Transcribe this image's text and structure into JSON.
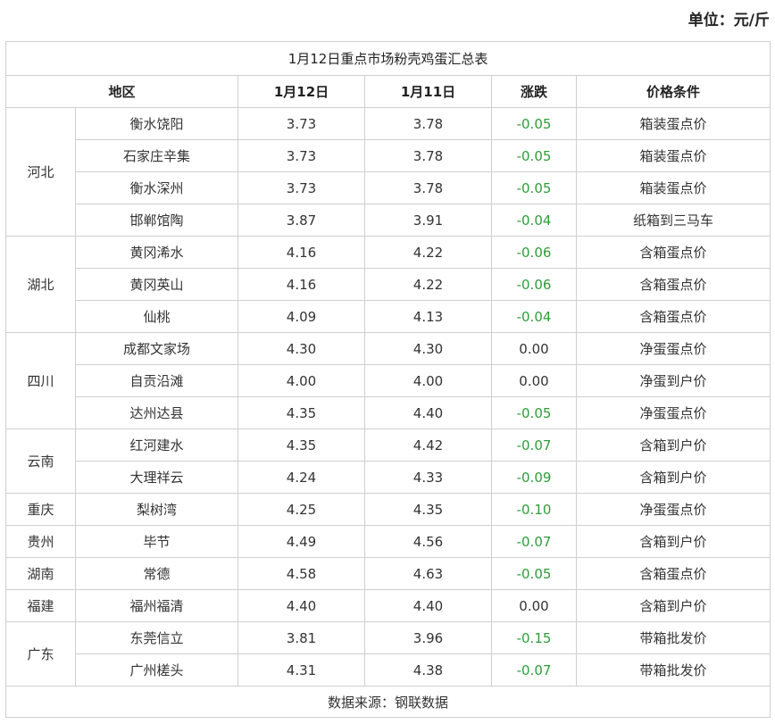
{
  "unit_label": "单位：元/斤",
  "table": {
    "title": "1月12日重点市场粉壳鸡蛋汇总表",
    "headers": [
      "地区",
      "1月12日",
      "1月11日",
      "涨跌",
      "价格条件"
    ],
    "rows": [
      {
        "region": "河北",
        "span": 4,
        "market": "衡水饶阳",
        "d12": "3.73",
        "d11": "3.78",
        "change": "-0.05",
        "condition": "箱装蛋点价"
      },
      {
        "market": "石家庄辛集",
        "d12": "3.73",
        "d11": "3.78",
        "change": "-0.05",
        "condition": "箱装蛋点价"
      },
      {
        "market": "衡水深州",
        "d12": "3.73",
        "d11": "3.78",
        "change": "-0.05",
        "condition": "箱装蛋点价"
      },
      {
        "market": "邯郸馆陶",
        "d12": "3.87",
        "d11": "3.91",
        "change": "-0.04",
        "condition": "纸箱到三马车"
      },
      {
        "region": "湖北",
        "span": 3,
        "market": "黄冈浠水",
        "d12": "4.16",
        "d11": "4.22",
        "change": "-0.06",
        "condition": "含箱蛋点价"
      },
      {
        "market": "黄冈英山",
        "d12": "4.16",
        "d11": "4.22",
        "change": "-0.06",
        "condition": "含箱蛋点价"
      },
      {
        "market": "仙桃",
        "d12": "4.09",
        "d11": "4.13",
        "change": "-0.04",
        "condition": "含箱蛋点价"
      },
      {
        "region": "四川",
        "span": 3,
        "market": "成都文家场",
        "d12": "4.30",
        "d11": "4.30",
        "change": "0.00",
        "condition": "净蛋蛋点价"
      },
      {
        "market": "自贡沿滩",
        "d12": "4.00",
        "d11": "4.00",
        "change": "0.00",
        "condition": "净蛋到户价"
      },
      {
        "market": "达州达县",
        "d12": "4.35",
        "d11": "4.40",
        "change": "-0.05",
        "condition": "净蛋蛋点价"
      },
      {
        "region": "云南",
        "span": 2,
        "market": "红河建水",
        "d12": "4.35",
        "d11": "4.42",
        "change": "-0.07",
        "condition": "含箱到户价"
      },
      {
        "market": "大理祥云",
        "d12": "4.24",
        "d11": "4.33",
        "change": "-0.09",
        "condition": "含箱到户价"
      },
      {
        "region": "重庆",
        "span": 1,
        "market": "梨树湾",
        "d12": "4.25",
        "d11": "4.35",
        "change": "-0.10",
        "condition": "净蛋蛋点价"
      },
      {
        "region": "贵州",
        "span": 1,
        "market": "毕节",
        "d12": "4.49",
        "d11": "4.56",
        "change": "-0.07",
        "condition": "含箱到户价"
      },
      {
        "region": "湖南",
        "span": 1,
        "market": "常德",
        "d12": "4.58",
        "d11": "4.63",
        "change": "-0.05",
        "condition": "含箱蛋点价"
      },
      {
        "region": "福建",
        "span": 1,
        "market": "福州福清",
        "d12": "4.40",
        "d11": "4.40",
        "change": "0.00",
        "condition": "含箱到户价"
      },
      {
        "region": "广东",
        "span": 2,
        "market": "东莞信立",
        "d12": "3.81",
        "d11": "3.96",
        "change": "-0.15",
        "condition": "带箱批发价"
      },
      {
        "market": "广州槎头",
        "d12": "4.31",
        "d11": "4.38",
        "change": "-0.07",
        "condition": "带箱批发价"
      }
    ],
    "footer": "数据来源：钢联数据"
  },
  "colors": {
    "negative_change": "#2e9d3a",
    "border": "#cfcfcf"
  }
}
